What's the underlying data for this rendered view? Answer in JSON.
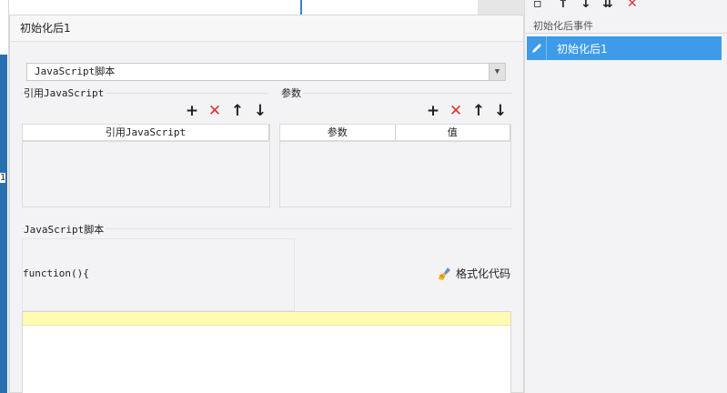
{
  "dialog": {
    "title": "初始化后1",
    "script_type": "JavaScript脚本",
    "ref_section": {
      "title": "引用JavaScript",
      "column": "引用JavaScript"
    },
    "param_section": {
      "title": "参数",
      "columns": [
        "参数",
        "值"
      ]
    },
    "script_section": {
      "title": "JavaScript脚本",
      "function_text": "function(){",
      "format_label": "格式化代码"
    }
  },
  "right_panel": {
    "title": "初始化后事件",
    "items": [
      {
        "label": "初始化后1"
      }
    ]
  },
  "left_edge_char": "1",
  "colors": {
    "selected": "#3d9be9",
    "highlight_line": "#fffbb0",
    "delete_red": "#e03030"
  }
}
